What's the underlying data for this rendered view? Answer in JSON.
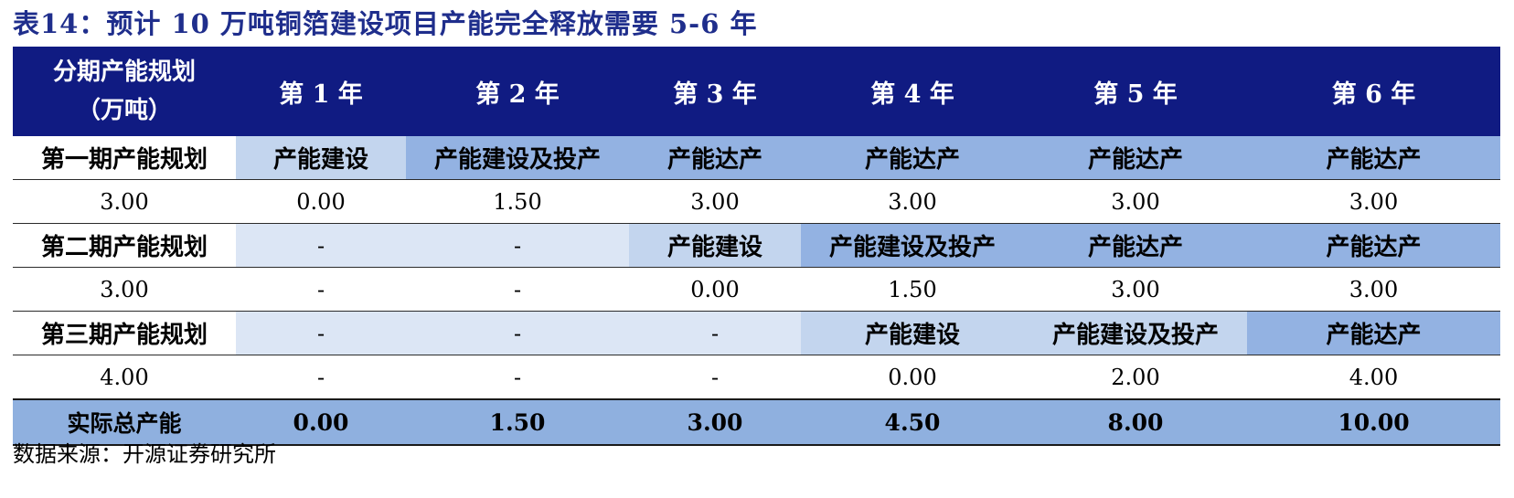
{
  "title": "表14：预计 10 万吨铜箔建设项目产能完全释放需要 5-6 年",
  "table": {
    "header": {
      "first_line1": "分期产能规划",
      "first_line2": "（万吨）",
      "years": [
        "第 1 年",
        "第 2 年",
        "第 3 年",
        "第 4 年",
        "第 5 年",
        "第 6 年"
      ]
    },
    "phase1": {
      "label": "第一期产能规划",
      "stages": [
        "产能建设",
        "产能建设及投产",
        "产能达产",
        "产能达产",
        "产能达产",
        "产能达产"
      ],
      "capacity": "3.00",
      "values": [
        "0.00",
        "1.50",
        "3.00",
        "3.00",
        "3.00",
        "3.00"
      ]
    },
    "phase2": {
      "label": "第二期产能规划",
      "stages": [
        "-",
        "-",
        "产能建设",
        "产能建设及投产",
        "产能达产",
        "产能达产"
      ],
      "capacity": "3.00",
      "values": [
        "-",
        "-",
        "0.00",
        "1.50",
        "3.00",
        "3.00"
      ]
    },
    "phase3": {
      "label": "第三期产能规划",
      "stages": [
        "-",
        "-",
        "-",
        "产能建设",
        "产能建设及投产",
        "产能达产"
      ],
      "capacity": "4.00",
      "values": [
        "-",
        "-",
        "-",
        "0.00",
        "2.00",
        "4.00"
      ]
    },
    "total": {
      "label": "实际总产能",
      "values": [
        "0.00",
        "1.50",
        "3.00",
        "4.50",
        "8.00",
        "10.00"
      ]
    }
  },
  "source": "数据来源：开源证券研究所",
  "colors": {
    "header_bg": "#101b82",
    "title_text": "#1f2e8c",
    "stage_light": "#dce6f5",
    "stage_mid": "#c3d5ee",
    "stage_dark": "#93b2e2",
    "total_bg": "#8fb0df"
  }
}
